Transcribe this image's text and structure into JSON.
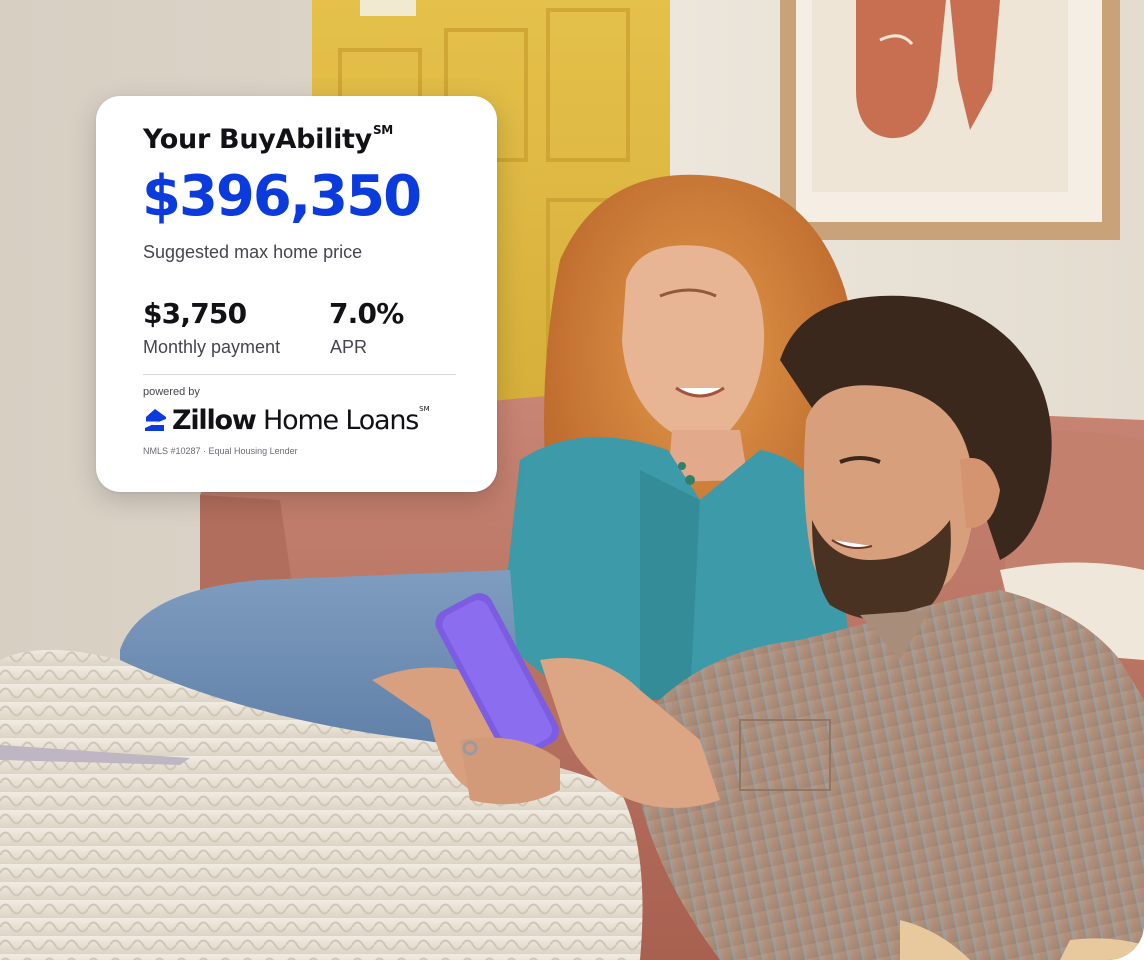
{
  "card": {
    "title": "Your BuyAbility",
    "title_superscript": "SM",
    "amount": "$396,350",
    "subtitle": "Suggested max home price",
    "stats": [
      {
        "value": "$3,750",
        "label": "Monthly payment"
      },
      {
        "value": "7.0%",
        "label": "APR"
      }
    ],
    "powered_by": "powered by",
    "brand_name_bold": "Zillow",
    "brand_name_regular": " Home Loans",
    "brand_superscript": "SM",
    "nmls": "NMLS #10287 · Equal Housing Lender"
  },
  "colors": {
    "accent": "#0b3bdc",
    "text_primary": "#111116",
    "text_secondary": "#45454f"
  },
  "photo": {
    "icon": "couple-on-couch-with-phone-photo"
  }
}
